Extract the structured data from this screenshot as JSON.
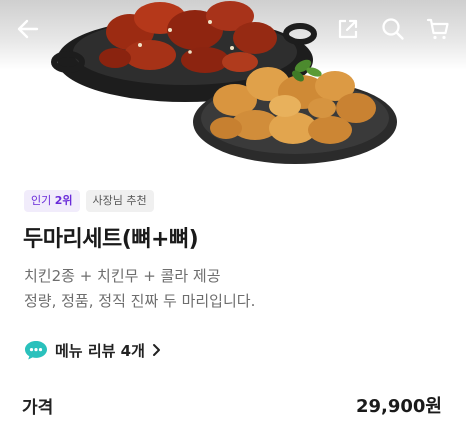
{
  "icons": {
    "back": "arrow-left-icon",
    "share": "share-icon",
    "search": "search-icon",
    "cart": "cart-icon",
    "review": "speech-bubble-icon",
    "review_chevron": "chevron-right-icon"
  },
  "badges": {
    "rank_prefix": "인기 ",
    "rank_value": "2위",
    "recommend": "사장님 추천"
  },
  "product": {
    "title": "두마리세트(뼈+뼈)",
    "description_lines": [
      "치킨2종 + 치킨무 + 콜라 제공",
      "정량, 정품, 정직 진짜 두 마리입니다."
    ],
    "review_label": "메뉴 리뷰 4개"
  },
  "price": {
    "label": "가격",
    "value": "29,900원"
  },
  "colors": {
    "accent_purple": "#6a2bd9",
    "review_icon": "#2ac1bc"
  }
}
